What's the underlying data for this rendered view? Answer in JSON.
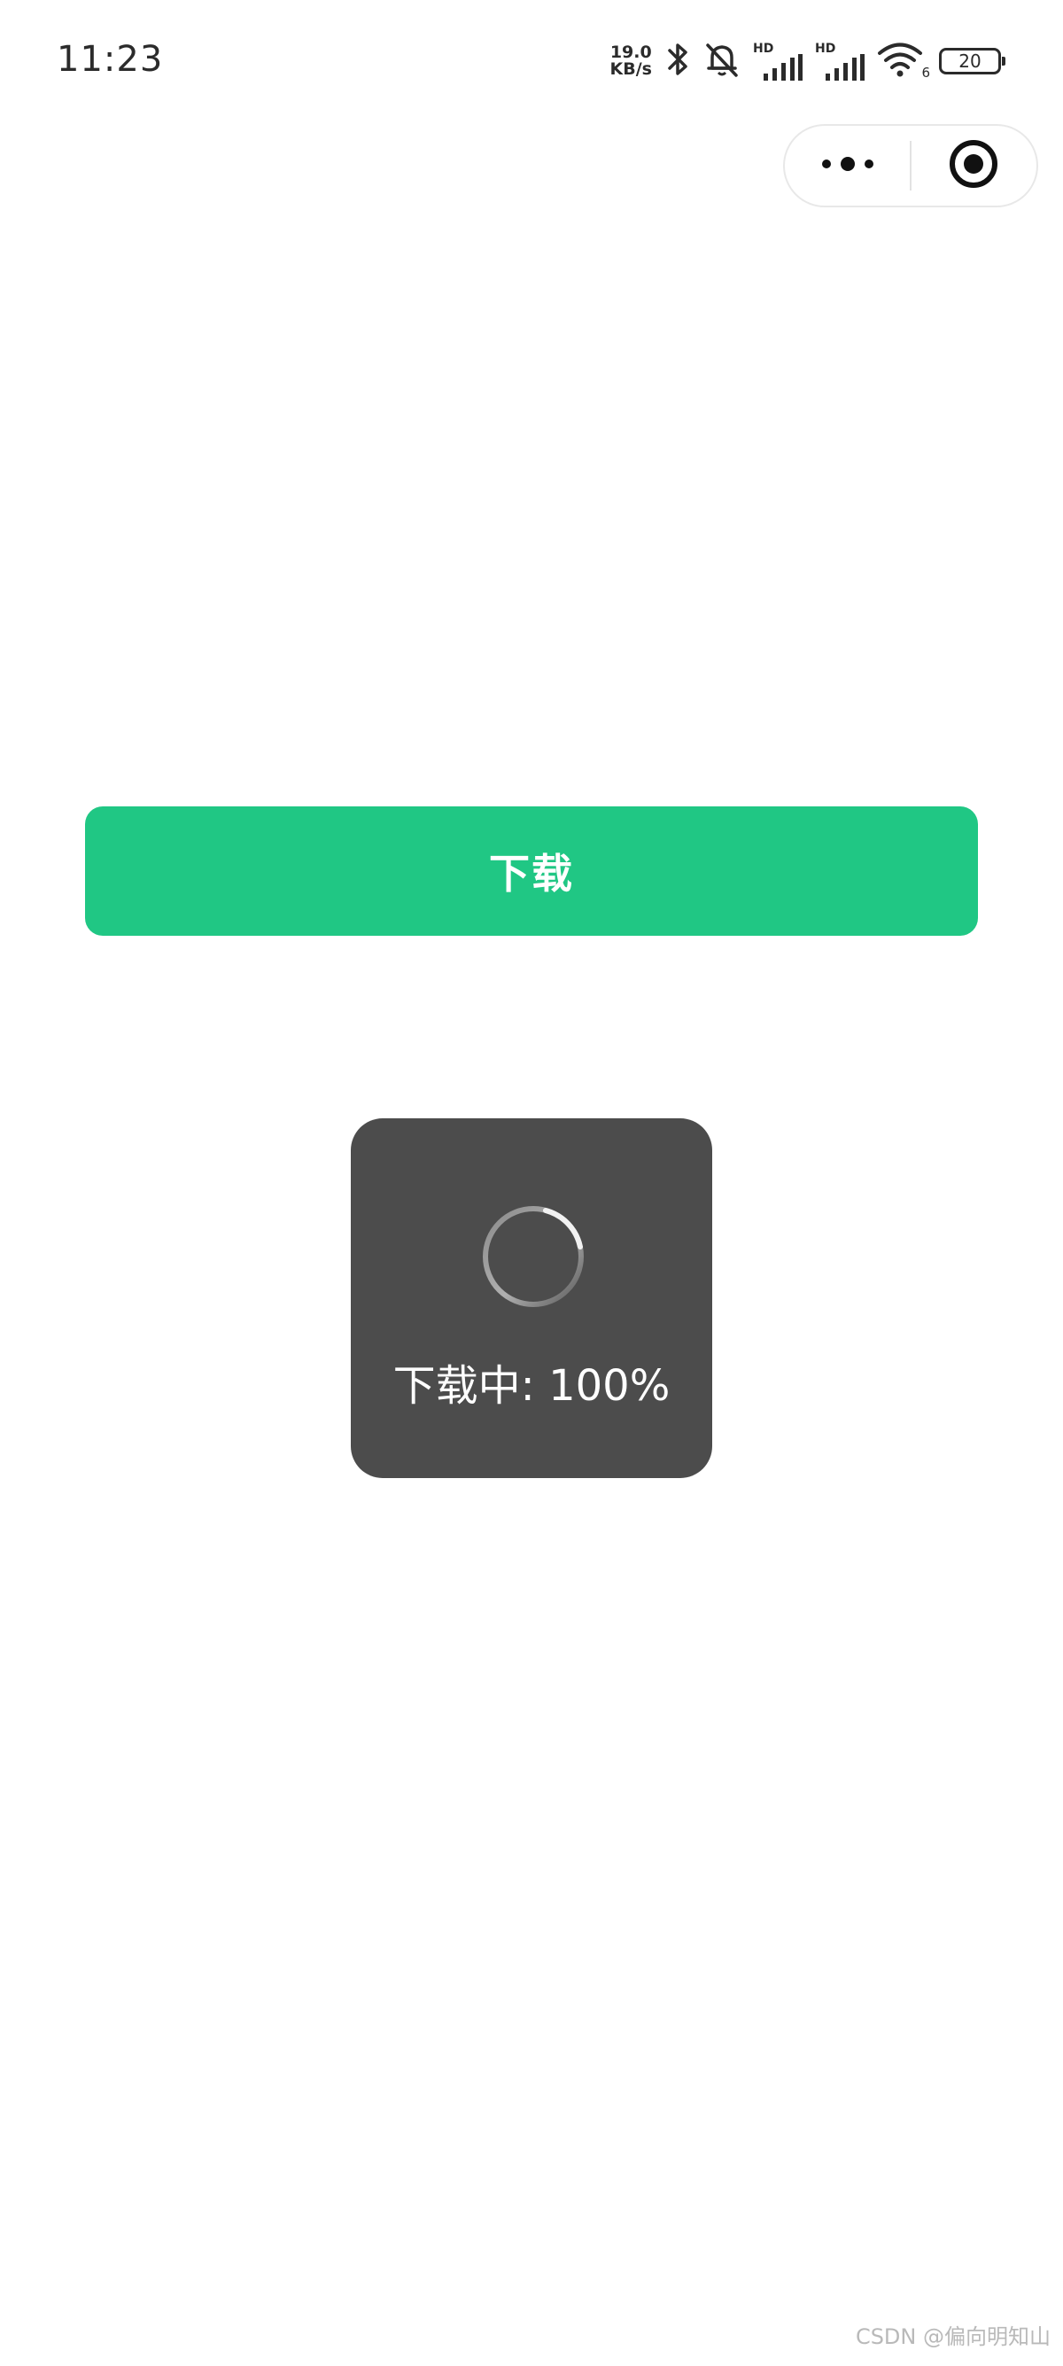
{
  "status_bar": {
    "time": "11:23",
    "net_speed_value": "19.0",
    "net_speed_unit": "KB/s",
    "signal_1_label": "HD",
    "signal_2_label": "HD",
    "wifi_label": "6",
    "battery_level": "20",
    "icons": [
      "bluetooth-icon",
      "mute-bell-icon",
      "hd-signal-icon",
      "hd-signal-icon",
      "wifi-icon",
      "battery-icon"
    ]
  },
  "capsule": {
    "icons": [
      "more-dots-icon",
      "close-target-icon"
    ]
  },
  "main": {
    "download_label": "下载"
  },
  "toast": {
    "text": "下载中: 100%",
    "icon": "loading-spinner-icon"
  },
  "watermark": {
    "text": "CSDN @偏向明知山"
  },
  "colors": {
    "primary": "#20c784",
    "toast_bg": "#4c4c4c",
    "background": "#ffffff"
  }
}
